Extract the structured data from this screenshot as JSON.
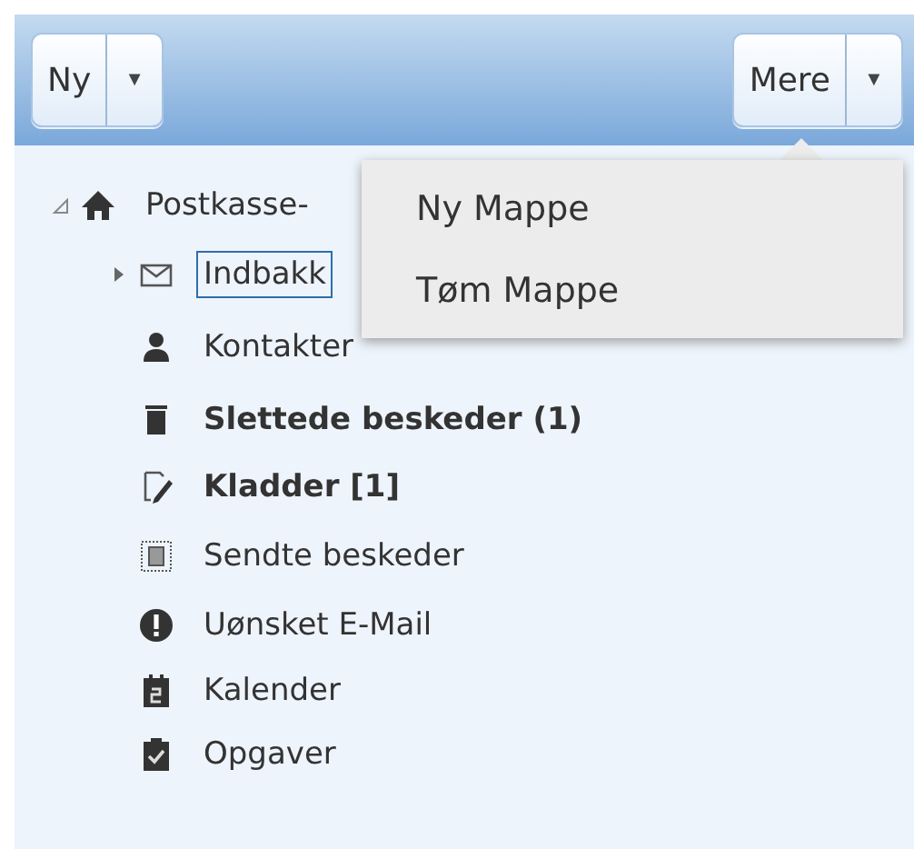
{
  "toolbar": {
    "buttons": [
      {
        "label": "Ny",
        "caret": "▼"
      },
      {
        "label": "Mere",
        "caret": "▼"
      }
    ]
  },
  "menu": {
    "items": [
      {
        "label": "Ny Mappe"
      },
      {
        "label": "Tøm Mappe"
      }
    ]
  },
  "tree": [
    {
      "label": "Postkasse-",
      "kind": "home",
      "expanded": true,
      "selected": false,
      "bold": false,
      "children": [
        {
          "label": "Indbakk",
          "kind": "inbox",
          "expanded": false,
          "selected": true,
          "bold": false
        },
        {
          "label": "Kontakter",
          "kind": "contacts",
          "selected": false,
          "bold": false
        },
        {
          "label": "Slettede beskeder (1)",
          "kind": "trash",
          "selected": false,
          "bold": true
        },
        {
          "label": "Kladder [1]",
          "kind": "drafts",
          "selected": false,
          "bold": true
        },
        {
          "label": "Sendte beskeder",
          "kind": "sent",
          "selected": false,
          "bold": false
        },
        {
          "label": "Uønsket E-Mail",
          "kind": "junk",
          "selected": false,
          "bold": false
        },
        {
          "label": "Kalender",
          "kind": "calendar",
          "selected": false,
          "bold": false
        },
        {
          "label": "Opgaver",
          "kind": "tasks",
          "selected": false,
          "bold": false
        }
      ]
    }
  ]
}
